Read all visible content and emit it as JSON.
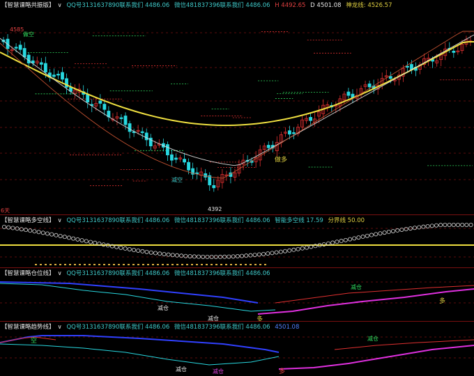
{
  "colors": {
    "bg": "#000000",
    "up": "#e03030",
    "down": "#28d8e0",
    "ma_yellow": "#f0e040",
    "ma_white": "#d8d8d8",
    "ma_red": "#c05030",
    "green": "#30e060",
    "magenta": "#e030e0",
    "blue": "#3040ff",
    "grid": "#7a1010"
  },
  "main": {
    "panel_name": "【智慧课略共振版】",
    "dropdown_icon": "chevron-down-icon",
    "qq": "QQ号3131637890联系我们 4486.06",
    "wechat": "微信481837396联系我们 4486.06",
    "h_label": "H 4492.65",
    "d_label": "D 4501.08",
    "shenlong": "神龙线: 4526.57",
    "high_mark": "4585",
    "low_mark": "4392",
    "buy_signal": "做多",
    "sell_signal": "做空",
    "reduce_signal": "减空",
    "days_label": "6天"
  },
  "p2": {
    "panel_name": "【智慧课略多空线】",
    "qq": "QQ号3131637890联系我们 4486.06",
    "wechat": "微信481837396联系我们 4486.06",
    "smart": "智能多空线 17.59",
    "boundary": "分界线 50.00"
  },
  "p3": {
    "panel_name": "【智慧课略仓位线】",
    "qq": "QQ号3131637890联系我们 4486.06",
    "wechat": "微信481837396联系我们 4486.06",
    "reduce1": "减仓",
    "reduce2": "减仓",
    "reduce3": "减仓",
    "more": "多",
    "more2": "多"
  },
  "p4": {
    "panel_name": "【智慧课略趋势线】",
    "qq": "QQ号3131637890联系我们 4486.06",
    "wechat": "微信481837396联系我们 4486.06",
    "value": "4501.08",
    "empty": "空",
    "reduce1": "减仓",
    "reduce2": "减仓",
    "reduce3": "减仓",
    "more": "多"
  }
}
